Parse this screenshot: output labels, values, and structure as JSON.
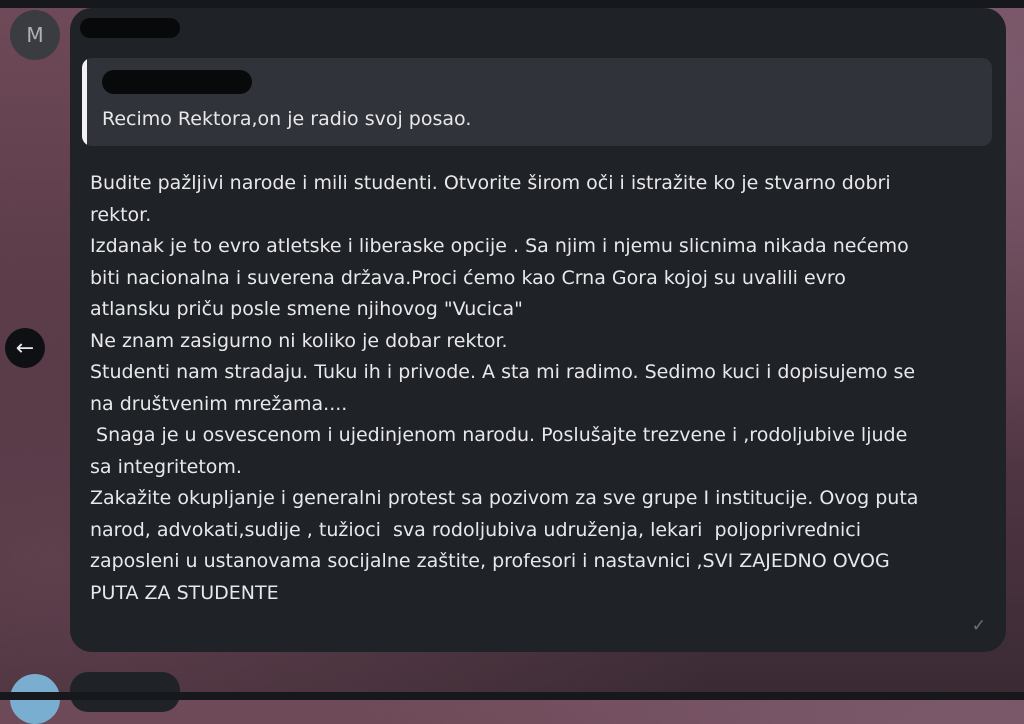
{
  "avatar_initial": "M",
  "nav": {
    "back_glyph": "←"
  },
  "message": {
    "quote_text": "Recimo Rektora,on je radio svoj posao.",
    "body": "Budite pažljivi narode i mili studenti. Otvorite širom oči i istražite ko je stvarno dobri\nrektor.\nIzdanak je to evro atletske i liberaske opcije . Sa njim i njemu slicnima nikada nećemo\nbiti nacionalna i suverena država.Proci ćemo kao Crna Gora kojoj su uvalili evro\natlansku priču posle smene njihovog \"Vucica\"\nNe znam zasigurno ni koliko je dobar rektor.\nStudenti nam stradaju. Tuku ih i privode. A sta mi radimo. Sedimo kuci i dopisujemo se\nna društvenim mrežama....\n Snaga je u osvescenom i ujedinjenom narodu. Poslušajte trezvene i ,rodoljubive ljude\nsa integritetom.\nZakažite okupljanje i generalni protest sa pozivom za sve grupe I institucije. Ovog puta\nnarod, advokati,sudije , tužioci  sva rodoljubiva udruženja, lekari  poljoprivrednici\nzaposleni u ustanovama socijalne zaštite, profesori i nastavnici ,SVI ZAJEDNO OVOG\nPUTA ZA STUDENTE",
    "status_icon": "read-check-icon",
    "status_glyph": "✓"
  }
}
